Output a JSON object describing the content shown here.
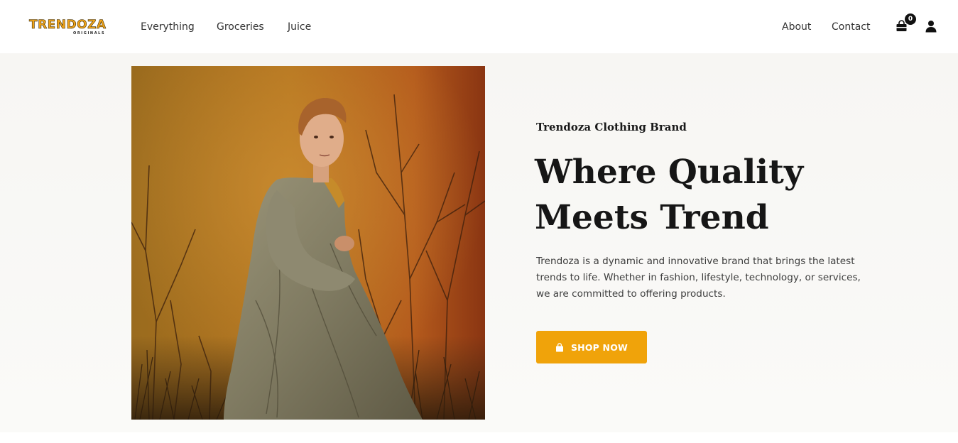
{
  "brand": {
    "logo_text": "TRENDOZA",
    "logo_subtext": "ORIGINALS",
    "accent_color": "#f0a30a"
  },
  "nav": {
    "left": [
      "Everything",
      "Groceries",
      "Juice"
    ],
    "right": [
      "About",
      "Contact"
    ]
  },
  "icons": {
    "cart": "shopping-bag-icon",
    "account": "user-icon"
  },
  "cart": {
    "count": "0"
  },
  "hero": {
    "image_alt": "model in oversized beige coat standing among dried branches",
    "eyebrow": "Trendoza Clothing Brand",
    "headline": "Where Quality Meets Trend",
    "description": "Trendoza is a dynamic and innovative brand that brings the latest trends to life. Whether in fashion, lifestyle, technology, or services, we are committed to offering products.",
    "cta_label": "SHOP NOW"
  }
}
